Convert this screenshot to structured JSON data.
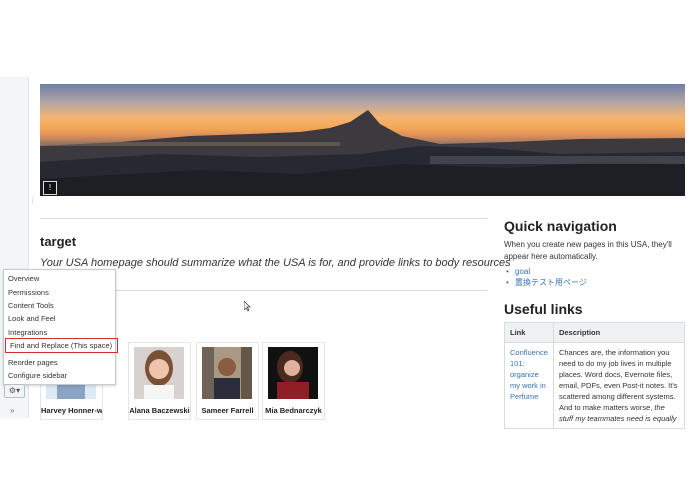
{
  "page": {
    "title": "target",
    "intro": "Your USA homepage should summarize what the USA is for, and provide links to body resources"
  },
  "quick_navigation": {
    "title": "Quick navigation",
    "description": "When you create new pages in this USA, they'll appear here automatically.",
    "items": [
      "goal",
      "置換テスト用ページ"
    ]
  },
  "useful_links": {
    "title": "Useful links",
    "columns": [
      "Link",
      "Description"
    ],
    "rows": [
      {
        "link": "Confluence 101: organize my work in Perfume",
        "description_plain": "Chances are, the information you need to do my job lives in multiple places. Word docs, Evernote files, email, PDFs, even Post-it notes. It's scattered among different systems. And to make matters worse, ",
        "description_em": "the stuff my teammates need is equally"
      }
    ]
  },
  "people": [
    {
      "name": "Harvey Honner-white"
    },
    {
      "name": "Alana Baczewski"
    },
    {
      "name": "Sameer Farrell"
    },
    {
      "name": "Mia Bednarczyk"
    }
  ],
  "space_menu": {
    "items": [
      "Overview",
      "Permissions",
      "Content Tools",
      "Look and Feel",
      "Integrations",
      "Find and Replace (This space)",
      "Reorder pages",
      "Configure sidebar"
    ],
    "highlighted_item": "Find and Replace (This space)"
  },
  "controls": {
    "gear_icon": "gear-icon",
    "expand_icon": "double-chevron-right-icon",
    "expand_label": "»",
    "gear_label": "⚙▾",
    "banner_badge_label": "!"
  },
  "colors": {
    "link": "#3572b0",
    "highlight_border": "#d22e2e"
  }
}
